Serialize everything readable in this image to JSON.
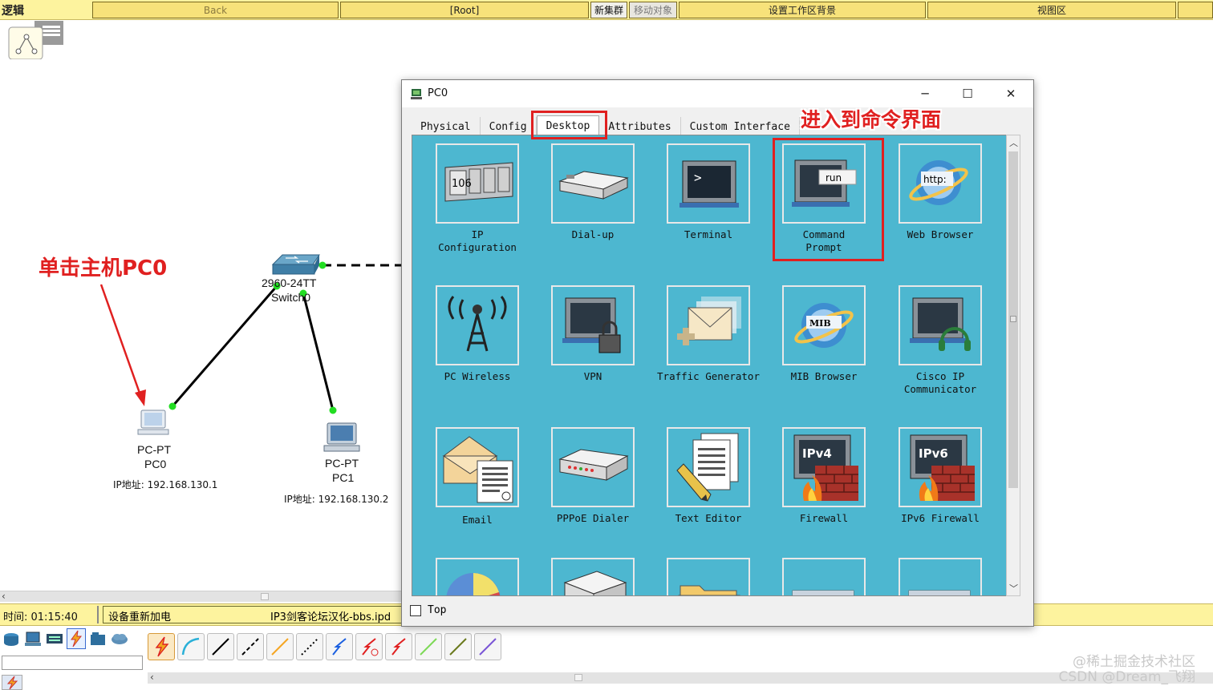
{
  "topbar": {
    "title": "逻辑",
    "back": "Back",
    "root": "[Root]",
    "new_cluster": "新集群",
    "move_object": "移动对象",
    "set_background": "设置工作区背景",
    "viewport": "视图区"
  },
  "annotations": {
    "click_pc0": "单击主机PC0",
    "enter_cmd": "进入到命令界面"
  },
  "devices": {
    "switch": {
      "model": "2960-24TT",
      "name": "Switch0"
    },
    "pc0": {
      "model": "PC-PT",
      "name": "PC0",
      "ip": "IP地址: 192.168.130.1"
    },
    "pc1": {
      "model": "PC-PT",
      "name": "PC1",
      "ip": "IP地址: 192.168.130.2"
    }
  },
  "status": {
    "time": "时间: 01:15:40",
    "message": "设备重新加电",
    "file": "IP3剑客论坛汉化-bbs.ipd"
  },
  "window": {
    "title": "PC0",
    "tabs": [
      "Physical",
      "Config",
      "Desktop",
      "Attributes",
      "Custom Interface"
    ],
    "active_tab": "Desktop",
    "apps": [
      {
        "icon": "ip-config-icon",
        "line1": "IP",
        "line2": "Configuration"
      },
      {
        "icon": "dialup-icon",
        "line1": "Dial-up",
        "line2": ""
      },
      {
        "icon": "terminal-icon",
        "line1": "Terminal",
        "line2": ""
      },
      {
        "icon": "command-prompt-icon",
        "line1": "Command",
        "line2": "Prompt"
      },
      {
        "icon": "web-browser-icon",
        "line1": "Web Browser",
        "line2": ""
      },
      {
        "icon": "pc-wireless-icon",
        "line1": "PC Wireless",
        "line2": ""
      },
      {
        "icon": "vpn-icon",
        "line1": "VPN",
        "line2": ""
      },
      {
        "icon": "traffic-generator-icon",
        "line1": "Traffic Generator",
        "line2": ""
      },
      {
        "icon": "mib-browser-icon",
        "line1": "MIB Browser",
        "line2": ""
      },
      {
        "icon": "cisco-ip-communicator-icon",
        "line1": "Cisco IP",
        "line2": "Communicator"
      },
      {
        "icon": "email-icon",
        "line1": "Email",
        "line2": ""
      },
      {
        "icon": "pppoe-dialer-icon",
        "line1": "PPPoE Dialer",
        "line2": ""
      },
      {
        "icon": "text-editor-icon",
        "line1": "Text Editor",
        "line2": ""
      },
      {
        "icon": "firewall-icon",
        "line1": "Firewall",
        "line2": ""
      },
      {
        "icon": "ipv6-firewall-icon",
        "line1": "IPv6 Firewall",
        "line2": ""
      }
    ],
    "icon_text": {
      "ip_number": "106",
      "run": "run",
      "http": "http:",
      "mib": "MIB",
      "ipv4": "IPv4",
      "ipv6": "IPv6",
      "prompt": ">"
    },
    "footer_checkbox": "Top"
  },
  "watermark": {
    "line1": "@稀土掘金技术社区",
    "line2": "CSDN @Dream_飞翔"
  },
  "colors": {
    "toolbar_yellow": "#fdf39e",
    "desktop_blue": "#4db7d0",
    "annotation_red": "#e02020",
    "link_green": "#22dd22"
  }
}
